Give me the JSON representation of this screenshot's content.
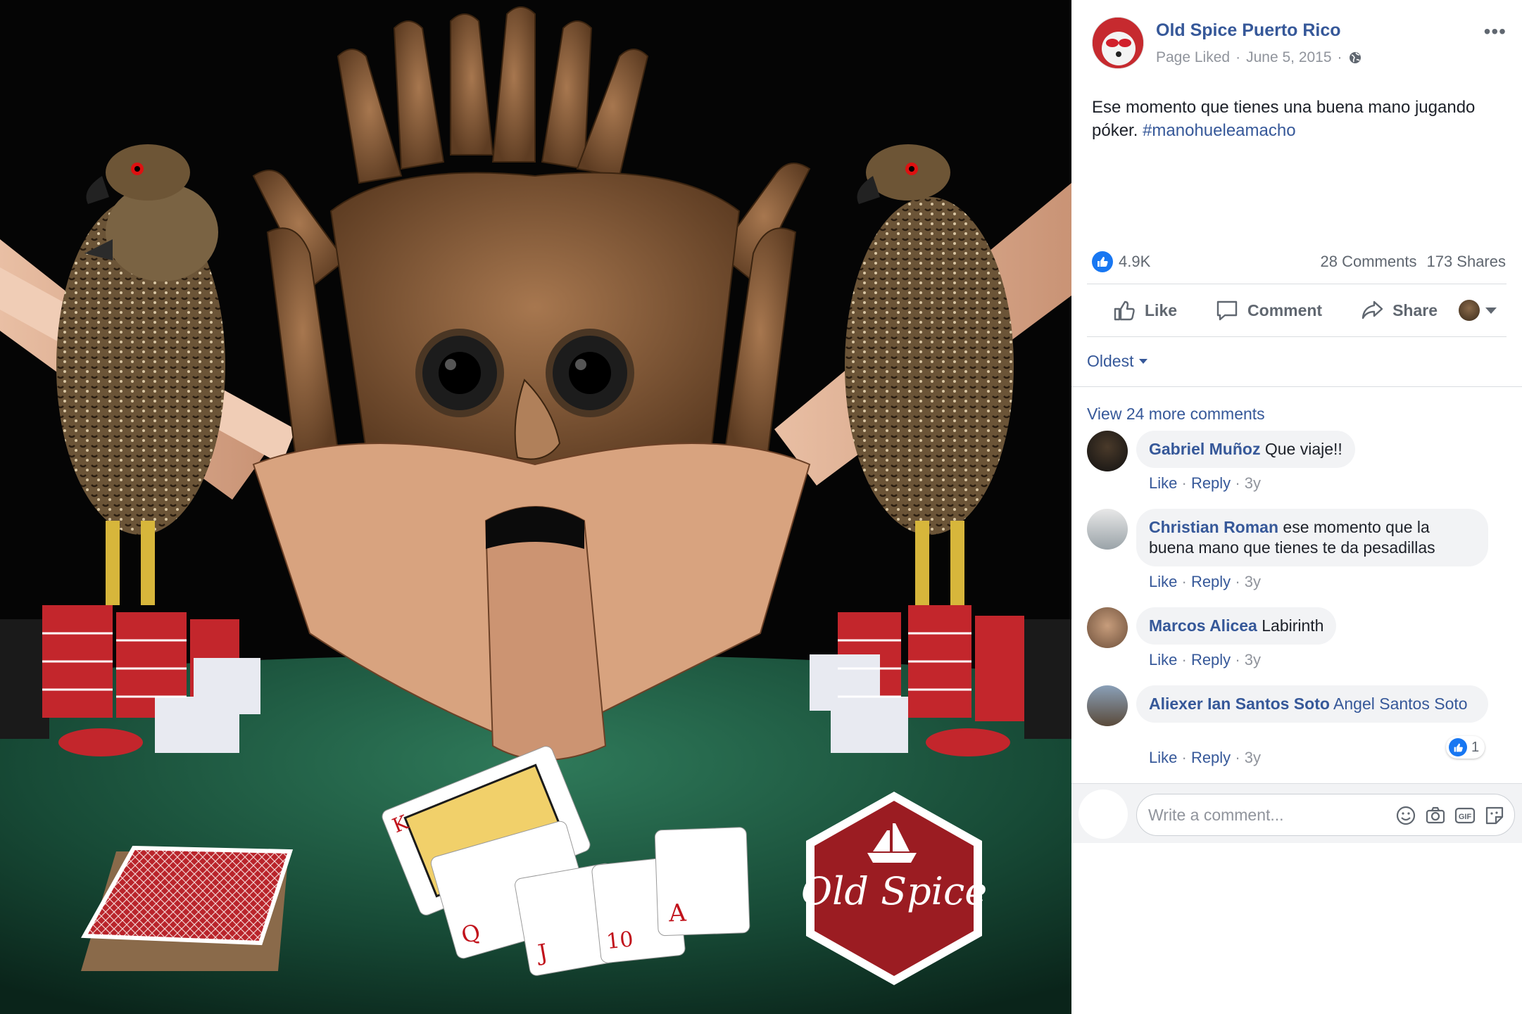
{
  "photo": {
    "logo_text": "Old Spice",
    "card_ranks": [
      "A",
      "K",
      "Q",
      "J",
      "10"
    ]
  },
  "post": {
    "page_name": "Old Spice Puerto Rico",
    "meta_liked": "Page Liked",
    "meta_sep": "·",
    "meta_date": "June 5, 2015",
    "text": "Ese momento que tienes una buena mano jugando póker.",
    "hashtag": "#manohueleamacho",
    "reactions_count": "4.9K",
    "comments_count": "28 Comments",
    "shares_count": "173 Shares"
  },
  "actions": {
    "like": "Like",
    "comment": "Comment",
    "share": "Share"
  },
  "comments_section": {
    "sort": "Oldest",
    "view_more": "View 24 more comments",
    "comments": [
      {
        "author": "Gabriel Muñoz",
        "text": "Que viaje!!",
        "like": "Like",
        "reply": "Reply",
        "age": "3y",
        "sep": "·"
      },
      {
        "author": "Christian Roman",
        "text": "ese momento que la buena mano que tienes te da pesadillas",
        "like": "Like",
        "reply": "Reply",
        "age": "3y",
        "sep": "·"
      },
      {
        "author": "Marcos Alicea",
        "text": "Labirinth",
        "like": "Like",
        "reply": "Reply",
        "age": "3y",
        "sep": "·"
      },
      {
        "author": "Aliexer Ian Santos Soto",
        "text": "Angel Santos Soto",
        "like": "Like",
        "reply": "Reply",
        "age": "3y",
        "sep": "·",
        "reaction_count": "1"
      }
    ]
  },
  "composer": {
    "placeholder": "Write a comment...",
    "gif_label": "GIF"
  },
  "colors": {
    "link": "#365899",
    "meta": "#90949c",
    "like_blue": "#1877f2",
    "bubble": "#f2f3f5",
    "felt": "#1d5a43",
    "logo_red": "#9b1c22"
  }
}
